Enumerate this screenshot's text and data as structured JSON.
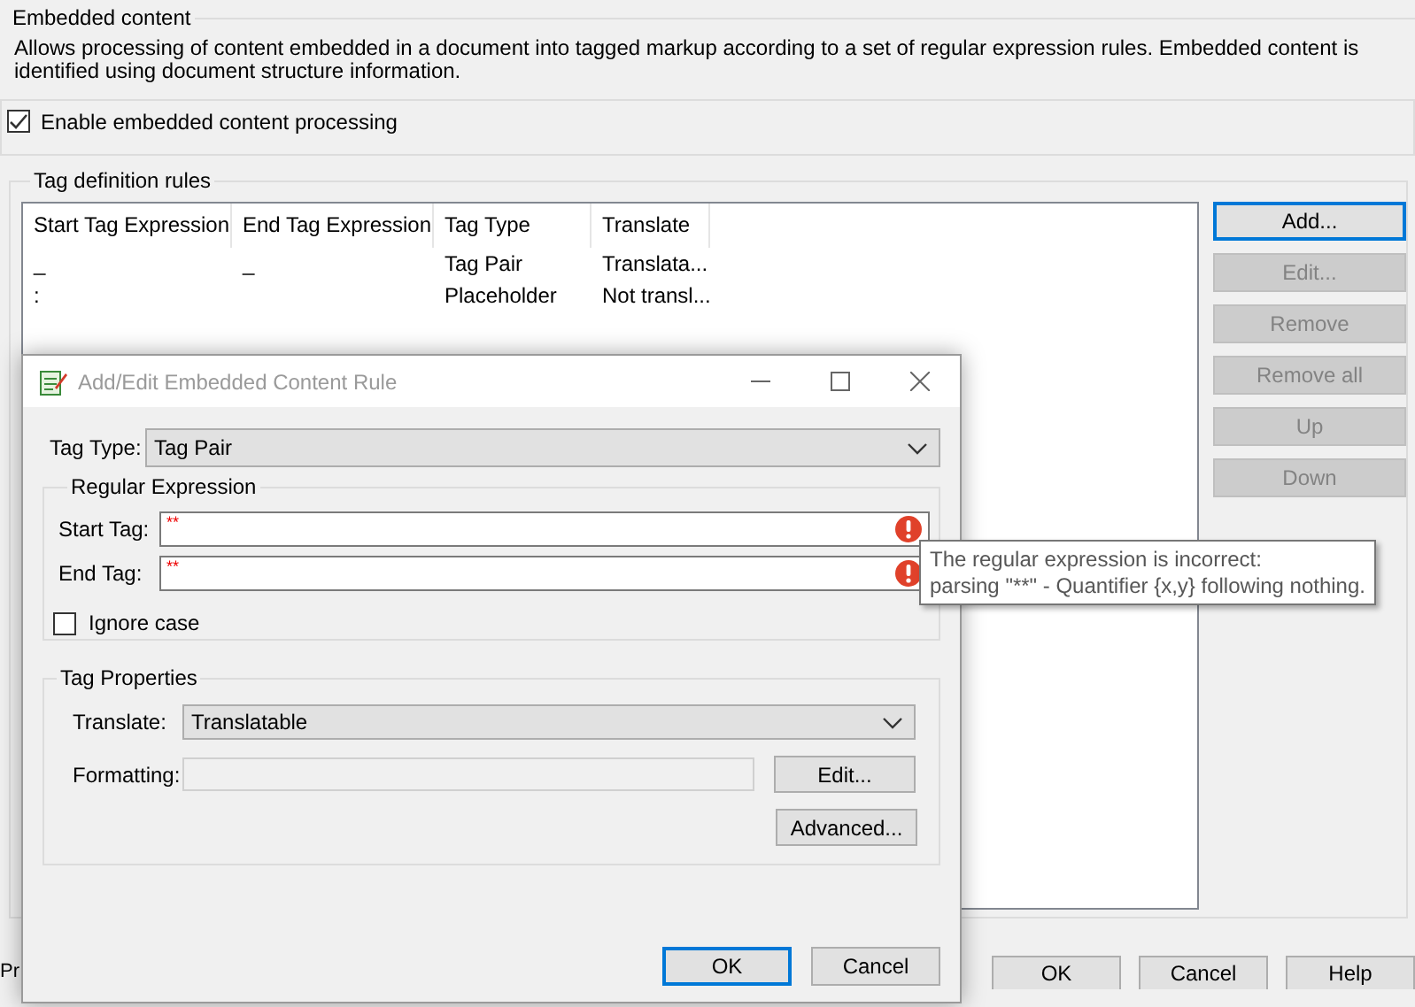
{
  "page": {
    "group_title": "Embedded content",
    "description": "Allows processing of content embedded in a document into tagged markup according to a set of regular expression rules. Embedded content is identified using document structure information.",
    "enable_checkbox": {
      "label": "Enable embedded content processing",
      "checked": true
    }
  },
  "rules": {
    "title": "Tag definition rules",
    "columns": [
      "Start Tag Expression",
      "End Tag Expression",
      "Tag Type",
      "Translate"
    ],
    "rows": [
      {
        "start": "_",
        "end": "_",
        "type": "Tag Pair",
        "translate": "Translata..."
      },
      {
        "start": ":",
        "type": "Placeholder",
        "translate": "Not transl..."
      }
    ],
    "buttons": [
      {
        "label": "Add...",
        "disabled": false,
        "focused": true
      },
      {
        "label": "Edit...",
        "disabled": true,
        "focused": false
      },
      {
        "label": "Remove",
        "disabled": true,
        "focused": false
      },
      {
        "label": "Remove all",
        "disabled": true,
        "focused": false
      },
      {
        "label": "Up",
        "disabled": true,
        "focused": false
      },
      {
        "label": "Down",
        "disabled": true,
        "focused": false
      }
    ]
  },
  "footer": {
    "partial_text": "Pr",
    "buttons": [
      "OK",
      "Cancel",
      "Help"
    ]
  },
  "dialog": {
    "title": "Add/Edit Embedded Content Rule",
    "tag_type": {
      "label": "Tag Type:",
      "value": "Tag Pair"
    },
    "regex": {
      "title": "Regular Expression",
      "fields": [
        {
          "label": "Start Tag:",
          "value": "**",
          "error": true
        },
        {
          "label": "End Tag:",
          "value": "**",
          "error": true
        }
      ],
      "ignore_case": {
        "label": "Ignore case",
        "checked": false
      }
    },
    "properties": {
      "title": "Tag Properties",
      "translate": {
        "label": "Translate:",
        "value": "Translatable"
      },
      "formatting": {
        "label": "Formatting:",
        "disabled": true,
        "edit_button": "Edit..."
      },
      "advanced_button": "Advanced..."
    },
    "buttons": [
      {
        "label": "OK",
        "focused": true
      },
      {
        "label": "Cancel",
        "focused": false
      }
    ]
  },
  "tooltip": {
    "lines": [
      "The regular expression is incorrect:",
      "parsing \"**\" - Quantifier {x,y} following nothing."
    ]
  }
}
